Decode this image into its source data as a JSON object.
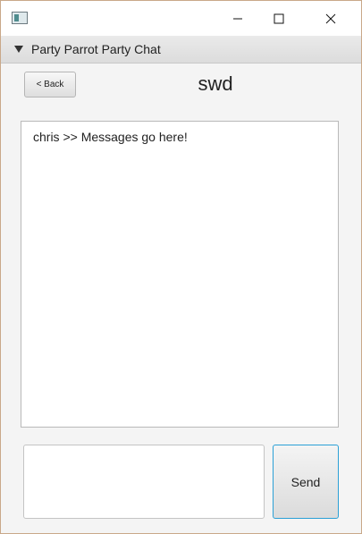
{
  "window": {
    "menu_title": "Party Parrot Party Chat"
  },
  "header": {
    "back_label": "< Back",
    "room_name": "swd"
  },
  "messages": [
    {
      "text": "chris >> Messages go here!"
    }
  ],
  "composer": {
    "value": "",
    "send_label": "Send"
  },
  "icons": {
    "app": "app-window-icon",
    "minimize": "minimize-icon",
    "maximize": "maximize-icon",
    "close": "close-icon",
    "menu": "triangle-down-icon"
  }
}
